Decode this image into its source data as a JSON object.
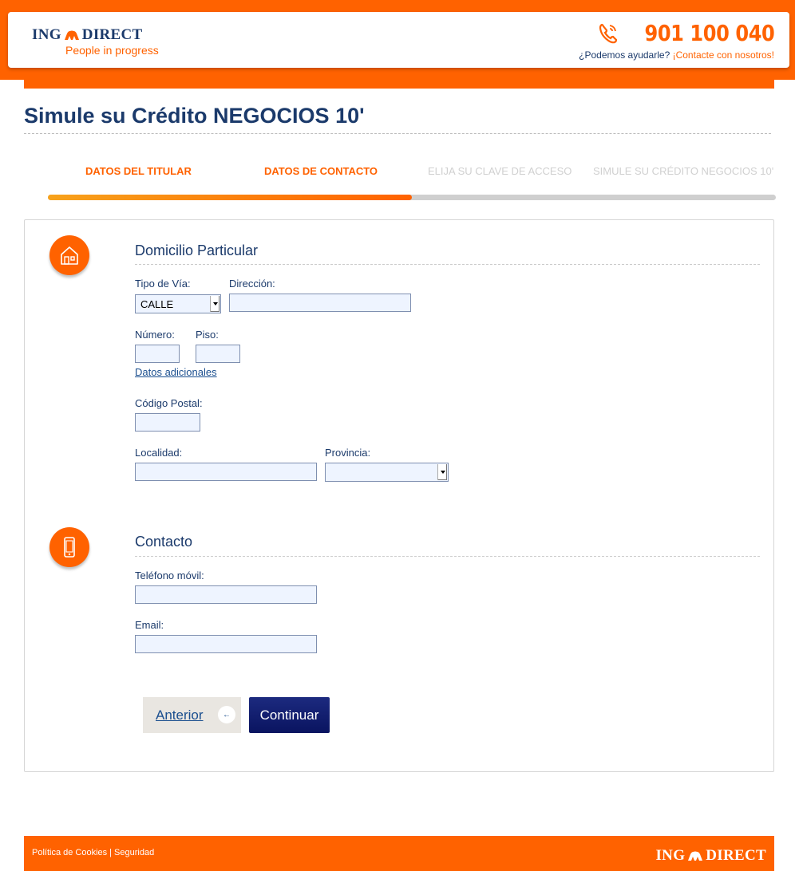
{
  "brand": {
    "name_left": "ING",
    "name_right": "DIRECT",
    "tagline": "People in progress",
    "color_orange": "#ff6200",
    "color_navy": "#1b3a6b"
  },
  "header": {
    "phone_number": "901 100 040",
    "help_question": "¿Podemos ayudarle?",
    "help_link": "¡Contacte con nosotros!"
  },
  "page": {
    "title": "Simule su Crédito NEGOCIOS 10'"
  },
  "steps": {
    "items": [
      {
        "label": "DATOS DEL TITULAR",
        "state": "done"
      },
      {
        "label": "DATOS DE CONTACTO",
        "state": "done"
      },
      {
        "label": "ELIJA SU CLAVE DE ACCESO",
        "state": "todo"
      },
      {
        "label": "SIMULE SU CRÉDITO NEGOCIOS 10'",
        "state": "todo"
      }
    ],
    "progress_fraction": 0.5
  },
  "domicilio": {
    "icon": "house-icon",
    "title": "Domicilio Particular",
    "tipo_via_label": "Tipo de Vía:",
    "tipo_via_value": "CALLE",
    "direccion_label": "Dirección:",
    "direccion_value": "",
    "numero_label": "Número:",
    "numero_value": "",
    "piso_label": "Piso:",
    "piso_value": "",
    "datos_adicionales_link": "Datos adicionales",
    "codigo_postal_label": "Código Postal:",
    "codigo_postal_value": "",
    "localidad_label": "Localidad:",
    "localidad_value": "",
    "provincia_label": "Provincia:",
    "provincia_value": ""
  },
  "contacto": {
    "icon": "mobile-phone-icon",
    "title": "Contacto",
    "movil_label": "Teléfono móvil:",
    "movil_value": "",
    "email_label": "Email:",
    "email_value": ""
  },
  "actions": {
    "prev_label": "Anterior",
    "next_label": "Continuar"
  },
  "footer": {
    "cookies_link": "Política de Cookies",
    "separator": "|",
    "security_link": "Seguridad",
    "logo_left": "ING",
    "logo_right": "DIRECT"
  }
}
